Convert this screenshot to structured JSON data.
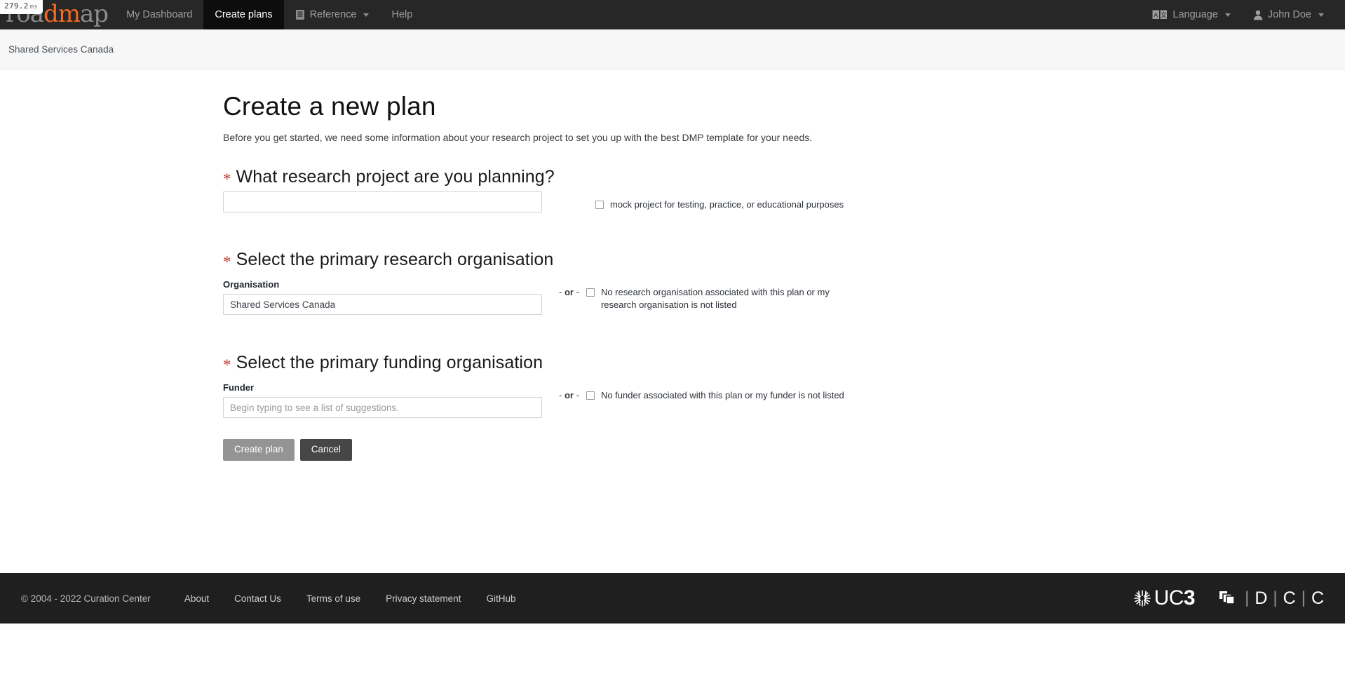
{
  "perf": {
    "value": "279.2",
    "unit": "ms"
  },
  "navbar": {
    "brand": {
      "grey_1": "roa",
      "orange": "dm",
      "grey_2": "ap",
      "full": "roadmap"
    },
    "items": [
      {
        "label": "My Dashboard",
        "active": false,
        "icon": null
      },
      {
        "label": "Create plans",
        "active": true,
        "icon": null
      },
      {
        "label": "Reference",
        "active": false,
        "icon": "book-icon",
        "caret": true
      },
      {
        "label": "Help",
        "active": false,
        "icon": null
      }
    ],
    "right": [
      {
        "label": "Language",
        "icon": "translate-icon",
        "caret": true
      },
      {
        "label": "John Doe",
        "icon": "user-icon",
        "caret": true
      }
    ]
  },
  "orgbar": {
    "organisation": "Shared Services Canada"
  },
  "page": {
    "title": "Create a new plan",
    "subtitle": "Before you get started, we need some information about your research project to set you up with the best DMP template for your needs."
  },
  "sections": {
    "project": {
      "required_marker": "*",
      "heading": "What research project are you planning?",
      "input_value": "",
      "input_placeholder": "",
      "mock_checkbox": {
        "label": "mock project for testing, practice, or educational purposes",
        "checked": false
      }
    },
    "research_org": {
      "required_marker": "*",
      "heading": "Select the primary research organisation",
      "field_label": "Organisation",
      "input_value": "Shared Services Canada",
      "input_placeholder": "",
      "or_text_pre": "-",
      "or_text": "or",
      "or_text_post": "-",
      "no_org_checkbox": {
        "label": "No research organisation associated with this plan or my research organisation is not listed",
        "checked": false
      }
    },
    "funder": {
      "required_marker": "*",
      "heading": "Select the primary funding organisation",
      "field_label": "Funder",
      "input_value": "",
      "input_placeholder": "Begin typing to see a list of suggestions.",
      "or_text_pre": "-",
      "or_text": "or",
      "or_text_post": "-",
      "no_funder_checkbox": {
        "label": "No funder associated with this plan or my funder is not listed",
        "checked": false
      }
    }
  },
  "actions": {
    "create_label": "Create plan",
    "cancel_label": "Cancel"
  },
  "footer": {
    "copyright": "© 2004 - 2022 Curation Center",
    "links": [
      "About",
      "Contact Us",
      "Terms of use",
      "Privacy statement",
      "GitHub"
    ],
    "logos": {
      "uc3_prefix": "UC",
      "uc3_suffix": "3",
      "dcc_letters": [
        "D",
        "C",
        "C"
      ],
      "dcc_separator": "|"
    }
  },
  "colors": {
    "navbar_bg": "#272727",
    "navbar_active_bg": "#0d0d0d",
    "brand_orange": "#f36b21",
    "required_red": "#c0392b",
    "footer_bg": "#1f1f1f",
    "primary_button": "#949494",
    "default_button": "#464646"
  }
}
